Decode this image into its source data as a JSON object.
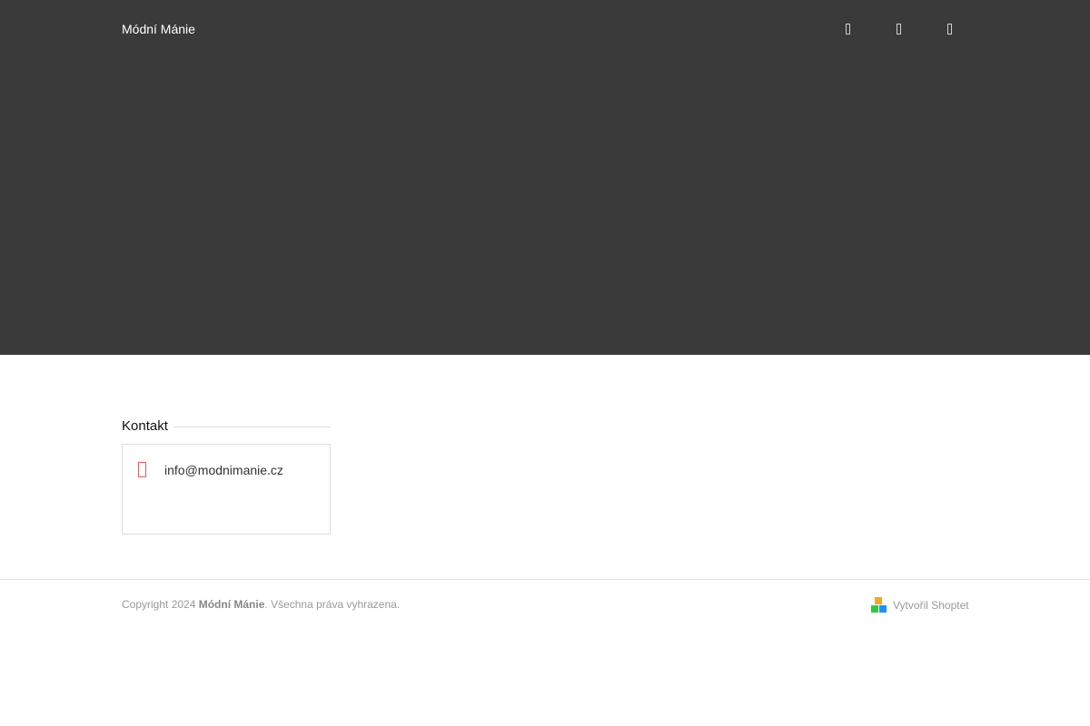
{
  "header": {
    "brand": "Módní Mánie",
    "nav_icons": [
      {
        "name": "search-icon"
      },
      {
        "name": "user-icon"
      },
      {
        "name": "cart-icon"
      }
    ]
  },
  "contact": {
    "heading": "Kontakt",
    "email": "info@modnimanie.cz",
    "email_icon": "envelope-icon"
  },
  "footer": {
    "copyright_prefix": "Copyright 2024 ",
    "copyright_brand": "Módní Mánie",
    "copyright_suffix": ". Všechna práva vyhrazena.",
    "shoptet_label": "Vytvořil Shoptet"
  },
  "colors": {
    "hero_background": "#3a3a3a",
    "icon_accent": "#e25a5a",
    "shoptet_top": "#f5a623",
    "shoptet_left": "#2ecc40",
    "shoptet_right": "#1e90ff"
  }
}
